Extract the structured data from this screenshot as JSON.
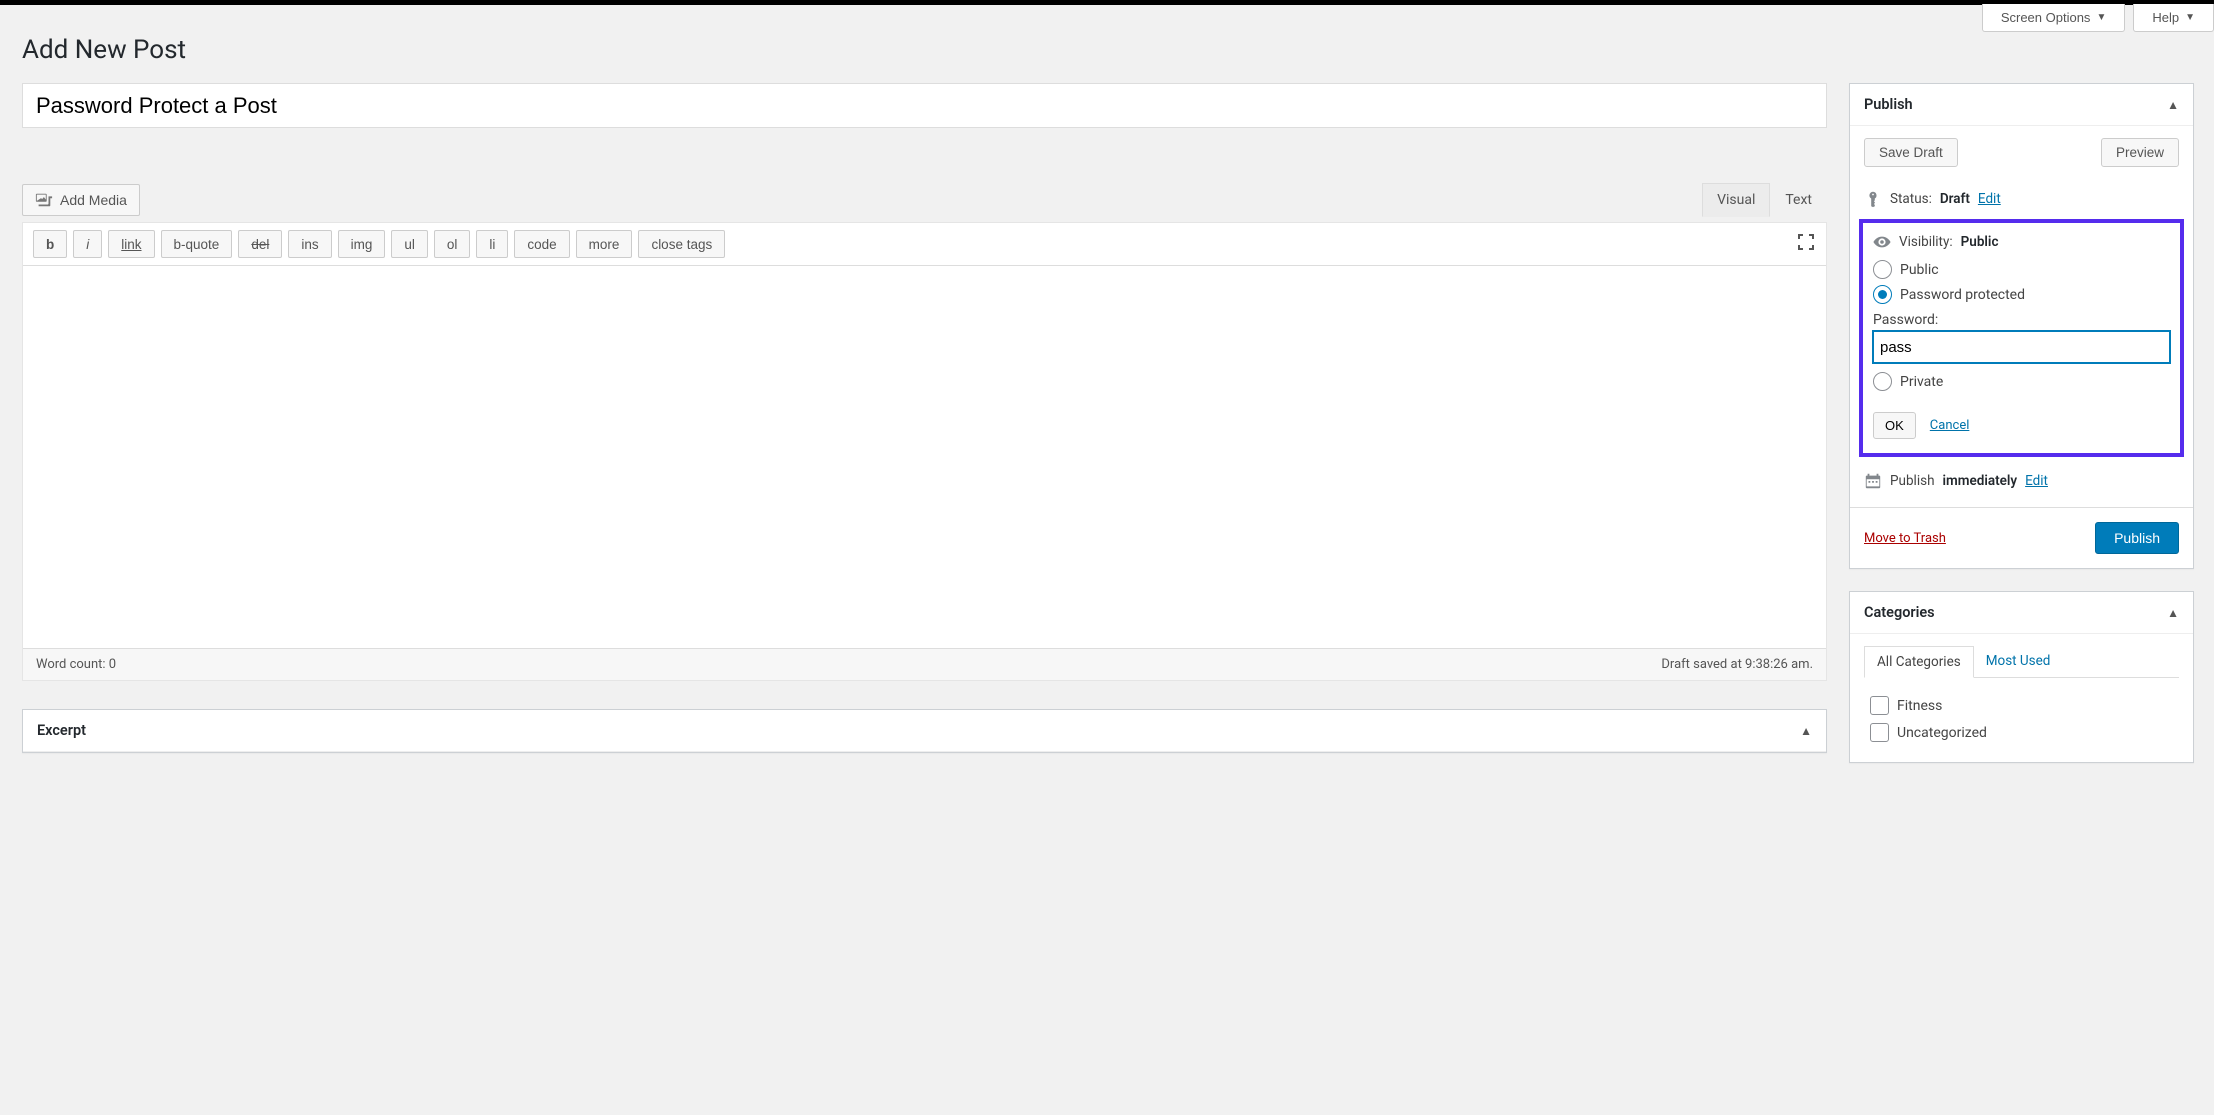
{
  "top_tabs": {
    "screen_options": "Screen Options",
    "help": "Help"
  },
  "page_title": "Add New Post",
  "post_title_value": "Password Protect a Post",
  "add_media": "Add Media",
  "editor_tabs": {
    "visual": "Visual",
    "text": "Text"
  },
  "quicktags": {
    "b": "b",
    "i": "i",
    "link": "link",
    "bquote": "b-quote",
    "del": "del",
    "ins": "ins",
    "img": "img",
    "ul": "ul",
    "ol": "ol",
    "li": "li",
    "code": "code",
    "more": "more",
    "close": "close tags"
  },
  "word_count_label": "Word count: 0",
  "draft_saved_label": "Draft saved at 9:38:26 am.",
  "publish_box": {
    "title": "Publish",
    "save_draft": "Save Draft",
    "preview": "Preview",
    "status_label": "Status:",
    "status_value": "Draft",
    "edit": "Edit",
    "visibility_label": "Visibility:",
    "visibility_value": "Public",
    "opt_public": "Public",
    "opt_password_protected": "Password protected",
    "password_label": "Password:",
    "password_value": "pass",
    "opt_private": "Private",
    "ok": "OK",
    "cancel": "Cancel",
    "publish_label_prefix": "Publish",
    "publish_value": "immediately",
    "trash": "Move to Trash",
    "publish_button": "Publish"
  },
  "categories_box": {
    "title": "Categories",
    "tab_all": "All Categories",
    "tab_used": "Most Used",
    "items": [
      "Fitness",
      "Uncategorized"
    ]
  },
  "excerpt_box": {
    "title": "Excerpt"
  }
}
